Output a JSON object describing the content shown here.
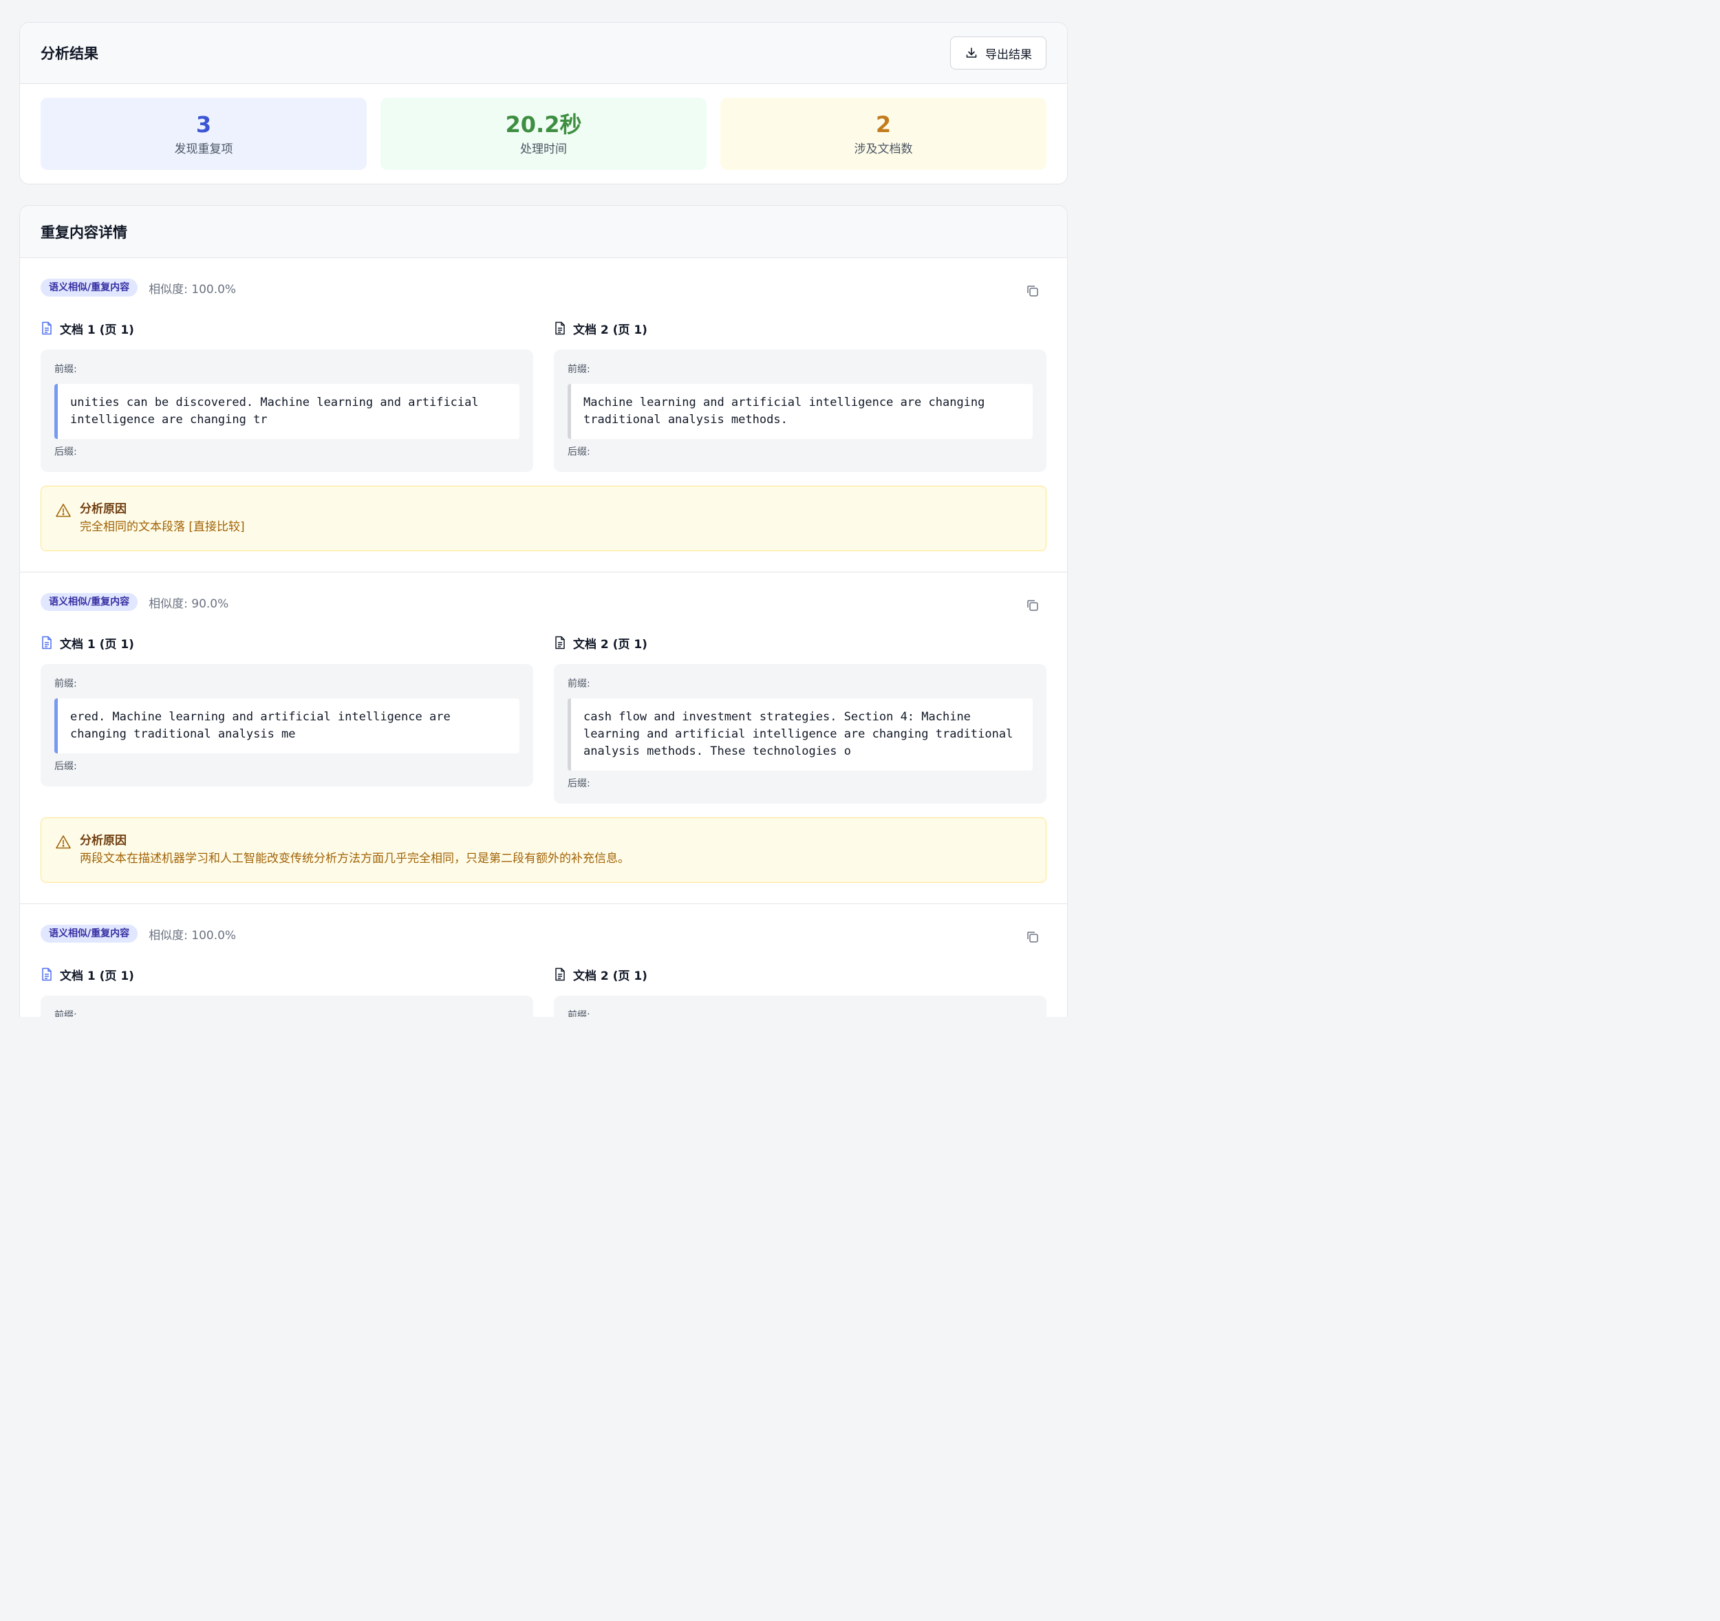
{
  "summary": {
    "title": "分析结果",
    "export_label": "导出结果",
    "stats": [
      {
        "value": "3",
        "label": "发现重复项",
        "color": "#3b55d4",
        "bg": "#eef2ff"
      },
      {
        "value": "20.2秒",
        "label": "处理时间",
        "color": "#3e8e41",
        "bg": "#f0fdf4"
      },
      {
        "value": "2",
        "label": "涉及文档数",
        "color": "#c27c1e",
        "bg": "#fefce8"
      }
    ]
  },
  "details": {
    "title": "重复内容详情",
    "items": [
      {
        "tag": "语义相似/重复内容",
        "similarity": "相似度: 100.0%",
        "doc1": {
          "title": "文档 1 (页 1)",
          "prefix": "前缀:",
          "suffix": "后缀:",
          "text": "unities can be discovered. Machine learning and artificial intelligence are changing tr"
        },
        "doc2": {
          "title": "文档 2 (页 1)",
          "prefix": "前缀:",
          "suffix": "后缀:",
          "text": "Machine learning and artificial intelligence are changing traditional analysis methods."
        },
        "reason_title": "分析原因",
        "reason_text": "完全相同的文本段落 [直接比较]"
      },
      {
        "tag": "语义相似/重复内容",
        "similarity": "相似度: 90.0%",
        "doc1": {
          "title": "文档 1 (页 1)",
          "prefix": "前缀:",
          "suffix": "后缀:",
          "text": "ered. Machine learning and artificial intelligence are changing traditional analysis me"
        },
        "doc2": {
          "title": "文档 2 (页 1)",
          "prefix": "前缀:",
          "suffix": "后缀:",
          "text": "cash flow and investment strategies. Section 4: Machine learning and artificial intelligence are changing traditional analysis methods. These technologies o"
        },
        "reason_title": "分析原因",
        "reason_text": "两段文本在描述机器学习和人工智能改变传统分析方法方面几乎完全相同，只是第二段有额外的补充信息。"
      },
      {
        "tag": "语义相似/重复内容",
        "similarity": "相似度: 100.0%",
        "doc1": {
          "title": "文档 1 (页 1)",
          "prefix": "前缀:"
        },
        "doc2": {
          "title": "文档 2 (页 1)",
          "prefix": "前缀:"
        }
      }
    ]
  },
  "icons": {
    "export": "download-icon",
    "copy": "copy-icon",
    "doc1": "document-icon-blue",
    "doc2": "document-icon-dark",
    "warning": "warning-triangle-icon"
  }
}
